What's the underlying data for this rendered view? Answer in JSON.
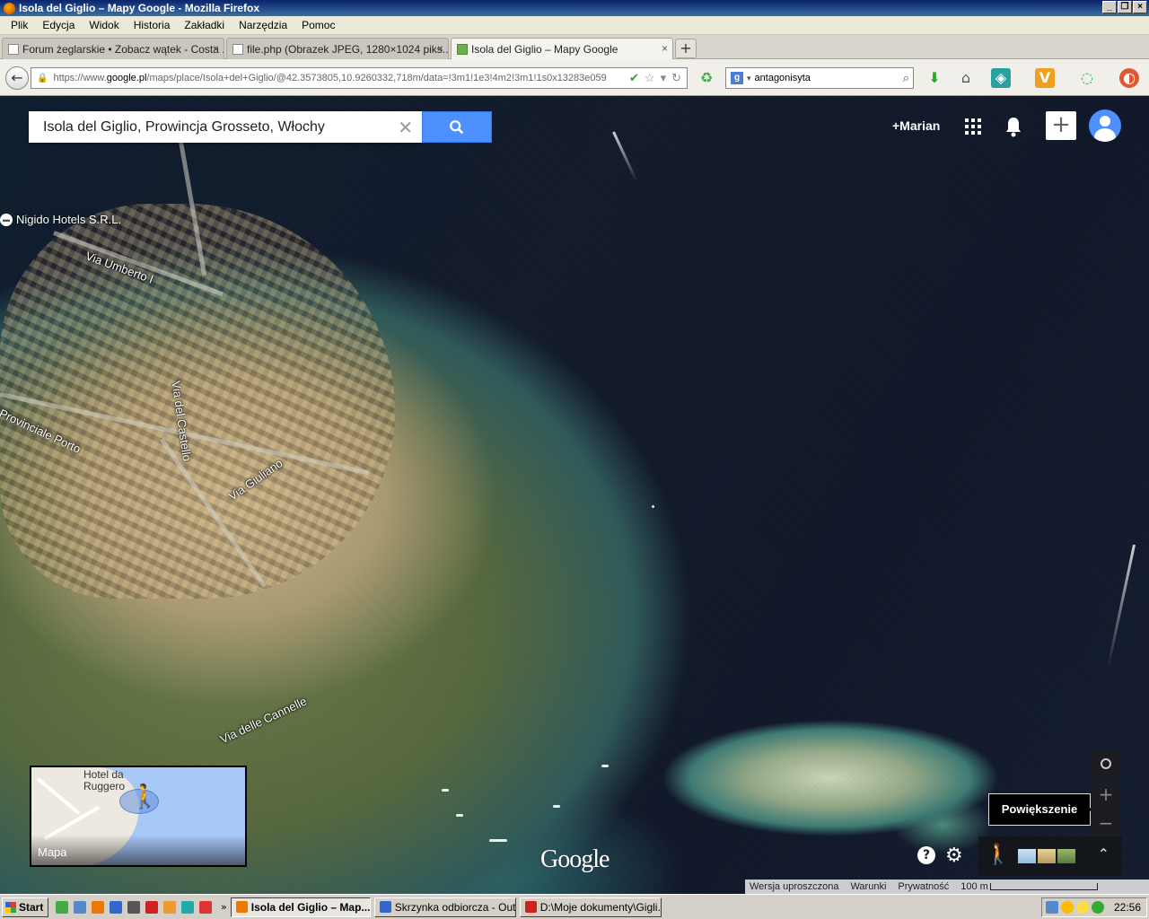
{
  "window": {
    "title": "Isola del Giglio – Mapy Google - Mozilla Firefox"
  },
  "menu": [
    "Plik",
    "Edycja",
    "Widok",
    "Historia",
    "Zakładki",
    "Narzędzia",
    "Pomoc"
  ],
  "tabs": [
    {
      "label": "Forum żeglarskie • Zobacz wątek - Costa ..."
    },
    {
      "label": "file.php (Obrazek JPEG, 1280×1024 piks..."
    },
    {
      "label": "Isola del Giglio – Mapy Google"
    }
  ],
  "nav": {
    "url_prefix": "https://www.",
    "url_domain": "google.pl",
    "url_rest": "/maps/place/Isola+del+Giglio/@42.3573805,10.9260332,718m/data=!3m1!1e3!4m2!3m1!1s0x13283e059",
    "search_engine_value": "antagonisyta"
  },
  "maps": {
    "search_value": "Isola del Giglio, Prowincja Grosseto, Włochy",
    "user_label": "+Marian",
    "poi_label": "Nigido Hotels S.R.L.",
    "streets": [
      "Via Umberto I",
      "Via del Castello",
      "Via Giuliano",
      "Provinciale Porto",
      "Via delle Cannelle"
    ],
    "minimap": {
      "place": "Hotel da Ruggero",
      "label": "Mapa"
    },
    "zoom_tooltip": "Powiększenie",
    "logo": "Google",
    "footer": [
      "Wersja uproszczona",
      "Warunki",
      "Prywatność",
      "100 m"
    ]
  },
  "taskbar": {
    "start": "Start",
    "tasks": [
      "Isola del Giglio – Map...",
      "Skrzynka odbiorcza - Out...",
      "D:\\Moje dokumenty\\Gigli..."
    ],
    "clock": "22:56"
  },
  "colors": {
    "accent": "#4d90fe",
    "titlebar": "#0a246a"
  }
}
